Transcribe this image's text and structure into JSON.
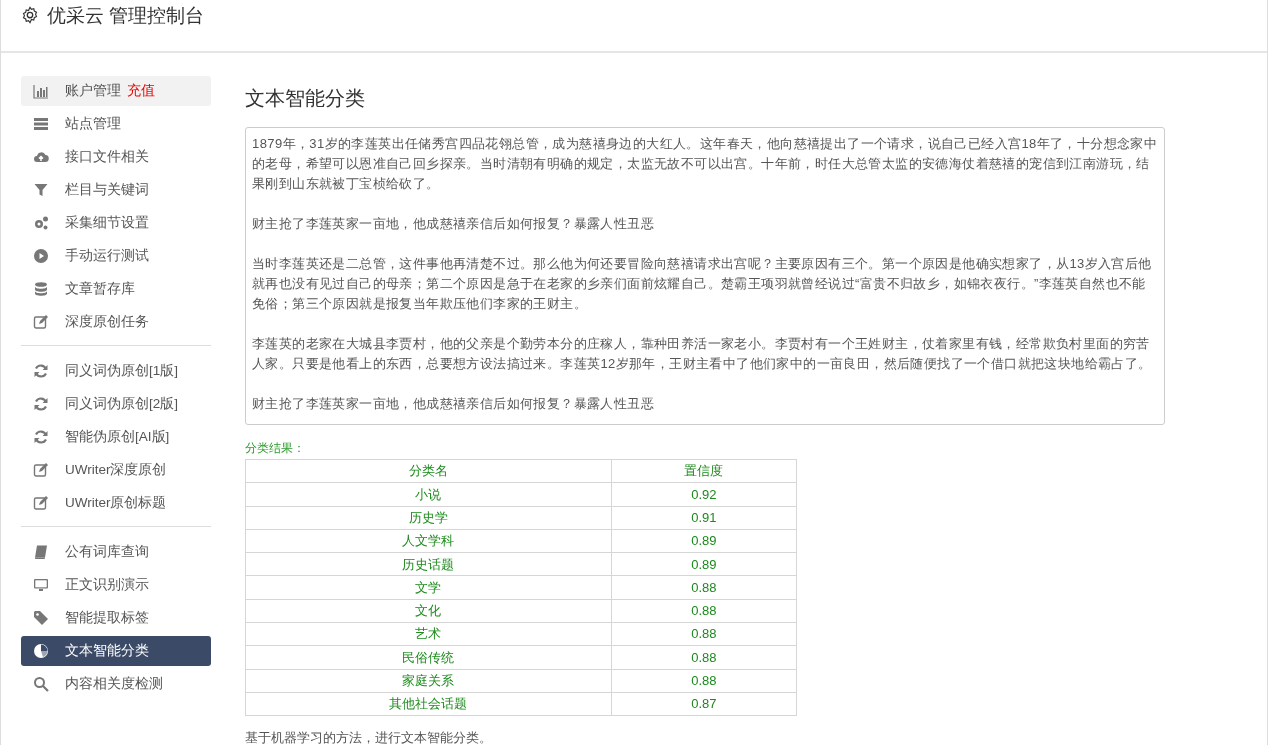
{
  "header": {
    "title": "优采云 管理控制台"
  },
  "sidebar": {
    "groups": [
      {
        "items": [
          {
            "label": "账户管理",
            "extra": "充值",
            "highlighted": true,
            "selected": false
          },
          {
            "label": "站点管理",
            "highlighted": false,
            "selected": false
          },
          {
            "label": "接口文件相关",
            "highlighted": false,
            "selected": false
          },
          {
            "label": "栏目与关键词",
            "highlighted": false,
            "selected": false
          },
          {
            "label": "采集细节设置",
            "highlighted": false,
            "selected": false
          },
          {
            "label": "手动运行测试",
            "highlighted": false,
            "selected": false
          },
          {
            "label": "文章暂存库",
            "highlighted": false,
            "selected": false
          },
          {
            "label": "深度原创任务",
            "highlighted": false,
            "selected": false
          }
        ]
      },
      {
        "items": [
          {
            "label": "同义词伪原创[1版]",
            "highlighted": false,
            "selected": false
          },
          {
            "label": "同义词伪原创[2版]",
            "highlighted": false,
            "selected": false
          },
          {
            "label": "智能伪原创[AI版]",
            "highlighted": false,
            "selected": false
          },
          {
            "label": "UWriter深度原创",
            "highlighted": false,
            "selected": false
          },
          {
            "label": "UWriter原创标题",
            "highlighted": false,
            "selected": false
          }
        ]
      },
      {
        "items": [
          {
            "label": "公有词库查询",
            "highlighted": false,
            "selected": false
          },
          {
            "label": "正文识别演示",
            "highlighted": false,
            "selected": false
          },
          {
            "label": "智能提取标签",
            "highlighted": false,
            "selected": false
          },
          {
            "label": "文本智能分类",
            "highlighted": false,
            "selected": true
          },
          {
            "label": "内容相关度检测",
            "highlighted": false,
            "selected": false
          }
        ]
      }
    ]
  },
  "main": {
    "title": "文本智能分类",
    "text_input": {
      "paragraphs": [
        "1879年，31岁的李莲英出任储秀宫四品花翎总管，成为慈禧身边的大红人。这年春天，他向慈禧提出了一个请求，说自己已经入宫18年了，十分想念家中的老母，希望可以恩准自己回乡探亲。当时清朝有明确的规定，太监无故不可以出宫。十年前，时任大总管太监的安德海仗着慈禧的宠信到江南游玩，结果刚到山东就被丁宝桢给砍了。",
        "财主抢了李莲英家一亩地，他成慈禧亲信后如何报复？暴露人性丑恶",
        "当时李莲英还是二总管，这件事他再清楚不过。那么他为何还要冒险向慈禧请求出宫呢？主要原因有三个。第一个原因是他确实想家了，从13岁入宫后他就再也没有见过自己的母亲；第二个原因是急于在老家的乡亲们面前炫耀自己。楚霸王项羽就曾经说过“富贵不归故乡，如锦衣夜行。”李莲英自然也不能免俗；第三个原因就是报复当年欺压他们李家的王财主。",
        "李莲英的老家在大城县李贾村，他的父亲是个勤劳本分的庄稼人，靠种田养活一家老小。李贾村有一个王姓财主，仗着家里有钱，经常欺负村里面的穷苦人家。只要是他看上的东西，总要想方设法搞过来。李莲英12岁那年，王财主看中了他们家中的一亩良田，然后随便找了一个借口就把这块地给霸占了。",
        "财主抢了李莲英家一亩地，他成慈禧亲信后如何报复？暴露人性丑恶"
      ]
    },
    "result_label": "分类结果：",
    "table": {
      "columns": [
        "分类名",
        "置信度"
      ],
      "rows": [
        [
          "小说",
          "0.92"
        ],
        [
          "历史学",
          "0.91"
        ],
        [
          "人文学科",
          "0.89"
        ],
        [
          "历史话题",
          "0.89"
        ],
        [
          "文学",
          "0.88"
        ],
        [
          "文化",
          "0.88"
        ],
        [
          "艺术",
          "0.88"
        ],
        [
          "民俗传统",
          "0.88"
        ],
        [
          "家庭关系",
          "0.88"
        ],
        [
          "其他社会话题",
          "0.87"
        ]
      ]
    },
    "note": "基于机器学习的方法，进行文本智能分类。"
  }
}
